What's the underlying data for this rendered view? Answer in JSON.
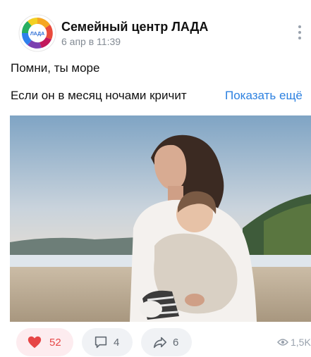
{
  "post": {
    "author": "Семейный центр ЛАДА",
    "avatar_text": "ЛАДА",
    "date": "6 апр в 11:39",
    "text_line1": "Помни, ты море",
    "text_line2": "Если он в месяц ночами кричит",
    "show_more": "Показать ещё",
    "photo_icon": "photo-mother-and-child-on-beach"
  },
  "actions": {
    "likes": "52",
    "comments": "4",
    "shares": "6",
    "views": "1,5K",
    "like_color": "#e64646",
    "icons": [
      "heart-icon",
      "comment-icon",
      "share-icon",
      "eye-icon"
    ]
  },
  "colors": {
    "link": "#2d81e0",
    "secondary_text": "#828a93",
    "pill_bg": "#f0f2f5"
  }
}
